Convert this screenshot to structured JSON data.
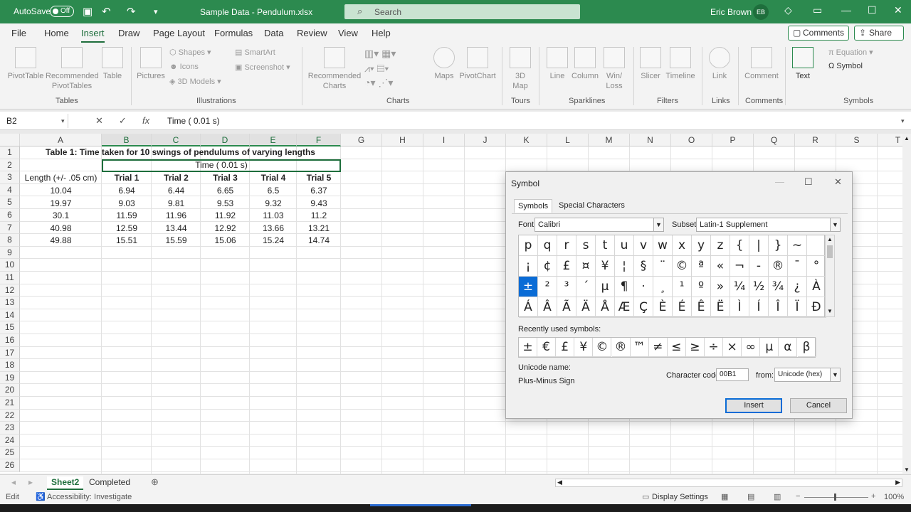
{
  "titlebar": {
    "autosave_label": "AutoSave",
    "autosave_state": "Off",
    "document_title": "Sample Data - Pendulum.xlsx",
    "search_placeholder": "Search",
    "user_name": "Eric Brown",
    "user_initials": "EB"
  },
  "menu": {
    "tabs": [
      "File",
      "Home",
      "Insert",
      "Draw",
      "Page Layout",
      "Formulas",
      "Data",
      "Review",
      "View",
      "Help"
    ],
    "active_tab": "Insert",
    "comments_label": "Comments",
    "share_label": "Share"
  },
  "ribbon": {
    "pivottable": "PivotTable",
    "recommended_pivottables": "Recommended PivotTables",
    "table": "Table",
    "pictures": "Pictures",
    "shapes": "Shapes",
    "icons": "Icons",
    "models_3d": "3D Models",
    "smartart": "SmartArt",
    "screenshot": "Screenshot",
    "recommended_charts": "Recommended Charts",
    "maps": "Maps",
    "pivotchart": "PivotChart",
    "map_3d": "3D Map",
    "line": "Line",
    "column": "Column",
    "winloss": "Win/ Loss",
    "slicer": "Slicer",
    "timeline": "Timeline",
    "link": "Link",
    "comment": "Comment",
    "text": "Text",
    "equation": "Equation",
    "symbol": "Symbol",
    "groups": {
      "tables": "Tables",
      "illustrations": "Illustrations",
      "charts": "Charts",
      "tours": "Tours",
      "sparklines": "Sparklines",
      "filters": "Filters",
      "links": "Links",
      "comments": "Comments",
      "symbols": "Symbols"
    }
  },
  "formula_bar": {
    "name_box": "B2",
    "content": "Time ( 0.01 s)"
  },
  "columns": [
    "A",
    "B",
    "C",
    "D",
    "E",
    "F",
    "G",
    "H",
    "I",
    "J",
    "K",
    "L",
    "M",
    "N",
    "O",
    "P",
    "Q",
    "R",
    "S",
    "T"
  ],
  "rows": [
    "1",
    "2",
    "3",
    "4",
    "5",
    "6",
    "7",
    "8",
    "9",
    "10",
    "11",
    "12",
    "13",
    "14",
    "15",
    "16",
    "17",
    "18",
    "19",
    "20",
    "21",
    "22",
    "23",
    "24",
    "25",
    "26"
  ],
  "sheet": {
    "title": "Table 1: Time taken for 10 swings of pendulums of varying lengths",
    "merged_header": "Time ( 0.01 s)",
    "headers": [
      "Length (+/- .05 cm)",
      "Trial 1",
      "Trial 2",
      "Trial 3",
      "Trial 4",
      "Trial 5"
    ],
    "data": [
      [
        "10.04",
        "6.94",
        "6.44",
        "6.65",
        "6.5",
        "6.37"
      ],
      [
        "19.97",
        "9.03",
        "9.81",
        "9.53",
        "9.32",
        "9.43"
      ],
      [
        "30.1",
        "11.59",
        "11.96",
        "11.92",
        "11.03",
        "11.2"
      ],
      [
        "40.98",
        "12.59",
        "13.44",
        "12.92",
        "13.66",
        "13.21"
      ],
      [
        "49.88",
        "15.51",
        "15.59",
        "15.06",
        "15.24",
        "14.74"
      ]
    ]
  },
  "sheet_tabs": [
    "Sheet2",
    "Completed"
  ],
  "active_sheet": "Sheet2",
  "status": {
    "mode": "Edit",
    "accessibility": "Accessibility: Investigate",
    "display_settings": "Display Settings",
    "zoom": "100%"
  },
  "dialog": {
    "title": "Symbol",
    "tabs": [
      "Symbols",
      "Special Characters"
    ],
    "font_label": "Font:",
    "font_value": "Calibri",
    "subset_label": "Subset:",
    "subset_value": "Latin-1 Supplement",
    "symbol_rows": [
      [
        "p",
        "q",
        "r",
        "s",
        "t",
        "u",
        "v",
        "w",
        "x",
        "y",
        "z",
        "{",
        "|",
        "}",
        "~",
        ""
      ],
      [
        "¡",
        "¢",
        "£",
        "¤",
        "¥",
        "¦",
        "§",
        "¨",
        "©",
        "ª",
        "«",
        "¬",
        "-",
        "®",
        "¯",
        "°"
      ],
      [
        "±",
        "²",
        "³",
        "´",
        "µ",
        "¶",
        "·",
        "¸",
        "¹",
        "º",
        "»",
        "¼",
        "½",
        "¾",
        "¿",
        "À"
      ],
      [
        "Á",
        "Â",
        "Ã",
        "Ä",
        "Å",
        "Æ",
        "Ç",
        "È",
        "É",
        "Ê",
        "Ë",
        "Ì",
        "Í",
        "Î",
        "Ï",
        "Ð"
      ]
    ],
    "selected_symbol": "±",
    "recent_label": "Recently used symbols:",
    "recent_symbols": [
      "±",
      "€",
      "£",
      "¥",
      "©",
      "®",
      "™",
      "≠",
      "≤",
      "≥",
      "÷",
      "×",
      "∞",
      "µ",
      "α",
      "β"
    ],
    "unicode_name_label": "Unicode name:",
    "unicode_name": "Plus-Minus Sign",
    "char_code_label": "Character code:",
    "char_code": "00B1",
    "from_label": "from:",
    "from_value": "Unicode (hex)",
    "insert_label": "Insert",
    "cancel_label": "Cancel"
  }
}
